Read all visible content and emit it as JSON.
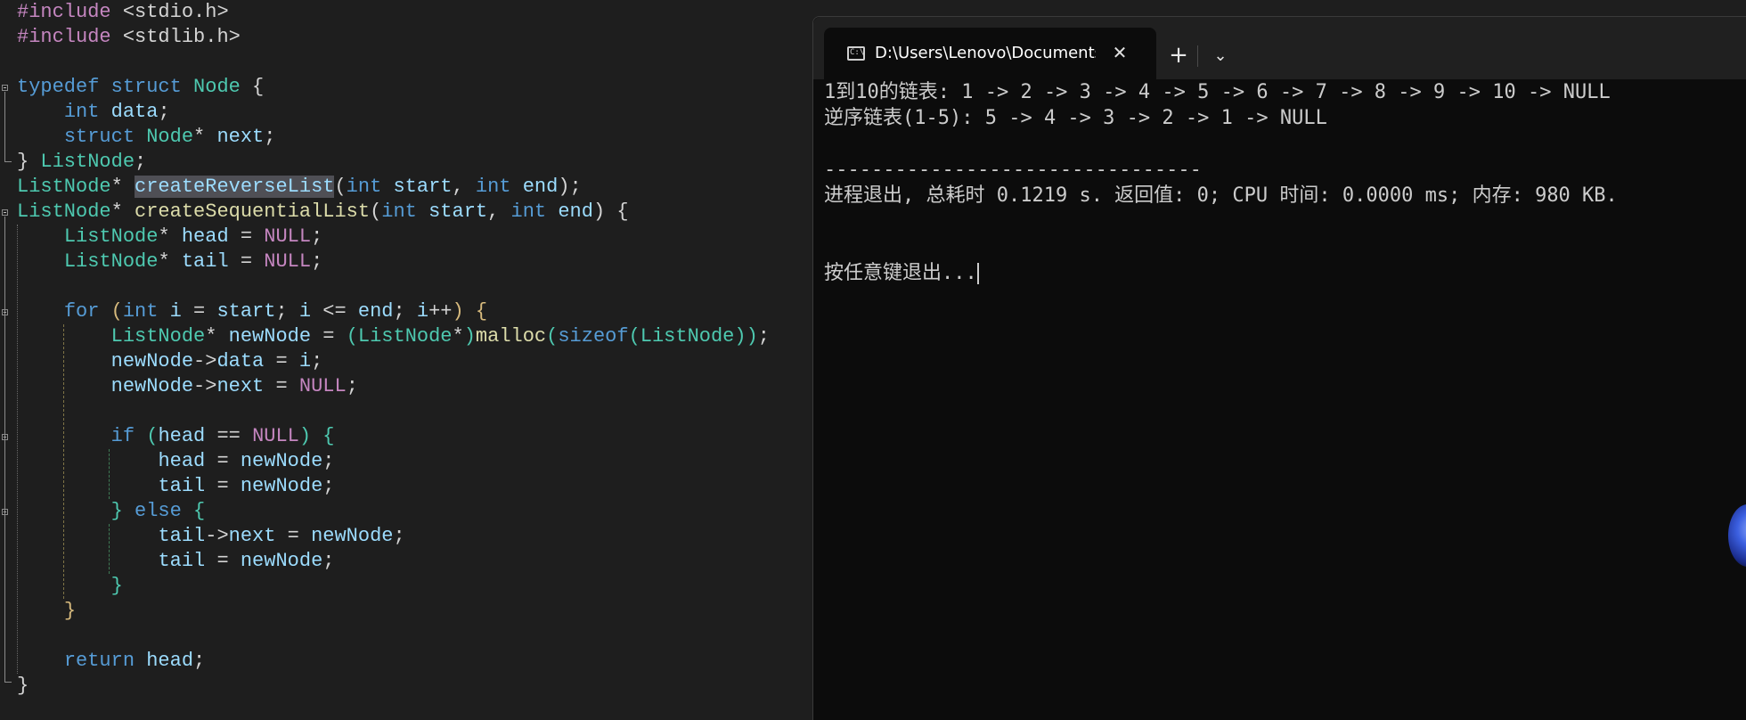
{
  "editor": {
    "lines": [
      [
        [
          "pp",
          "#include "
        ],
        [
          "txt",
          "<stdio.h>"
        ]
      ],
      [
        [
          "pp",
          "#include "
        ],
        [
          "txt",
          "<stdlib.h>"
        ]
      ],
      [],
      [
        [
          "kw",
          "typedef"
        ],
        [
          "txt",
          " "
        ],
        [
          "kw",
          "struct"
        ],
        [
          "txt",
          " "
        ],
        [
          "ty",
          "Node"
        ],
        [
          "txt",
          " {"
        ]
      ],
      [
        [
          "txt",
          "    "
        ],
        [
          "kw",
          "int"
        ],
        [
          "txt",
          " "
        ],
        [
          "va",
          "data"
        ],
        [
          "txt",
          ";"
        ]
      ],
      [
        [
          "txt",
          "    "
        ],
        [
          "kw",
          "struct"
        ],
        [
          "txt",
          " "
        ],
        [
          "ty",
          "Node"
        ],
        [
          "txt",
          "* "
        ],
        [
          "va",
          "next"
        ],
        [
          "txt",
          ";"
        ]
      ],
      [
        [
          "txt",
          "} "
        ],
        [
          "ty",
          "ListNode"
        ],
        [
          "txt",
          ";"
        ]
      ],
      [
        [
          "ty",
          "ListNode"
        ],
        [
          "txt",
          "* "
        ],
        [
          "hl",
          "createReverseList"
        ],
        [
          "txt",
          "("
        ],
        [
          "kw",
          "int"
        ],
        [
          "txt",
          " "
        ],
        [
          "va",
          "start"
        ],
        [
          "txt",
          ", "
        ],
        [
          "kw",
          "int"
        ],
        [
          "txt",
          " "
        ],
        [
          "va",
          "end"
        ],
        [
          "txt",
          ");"
        ]
      ],
      [
        [
          "ty",
          "ListNode"
        ],
        [
          "txt",
          "* "
        ],
        [
          "fn",
          "createSequentialList"
        ],
        [
          "txt",
          "("
        ],
        [
          "kw",
          "int"
        ],
        [
          "txt",
          " "
        ],
        [
          "va",
          "start"
        ],
        [
          "txt",
          ", "
        ],
        [
          "kw",
          "int"
        ],
        [
          "txt",
          " "
        ],
        [
          "va",
          "end"
        ],
        [
          "txt",
          ") {"
        ]
      ],
      [
        [
          "txt",
          "    "
        ],
        [
          "ty",
          "ListNode"
        ],
        [
          "txt",
          "* "
        ],
        [
          "va",
          "head"
        ],
        [
          "txt",
          " = "
        ],
        [
          "nu",
          "NULL"
        ],
        [
          "txt",
          ";"
        ]
      ],
      [
        [
          "txt",
          "    "
        ],
        [
          "ty",
          "ListNode"
        ],
        [
          "txt",
          "* "
        ],
        [
          "va",
          "tail"
        ],
        [
          "txt",
          " = "
        ],
        [
          "nu",
          "NULL"
        ],
        [
          "txt",
          ";"
        ]
      ],
      [],
      [
        [
          "txt",
          "    "
        ],
        [
          "kw",
          "for"
        ],
        [
          "txt",
          " "
        ],
        [
          "pa",
          "("
        ],
        [
          "kw",
          "int"
        ],
        [
          "txt",
          " "
        ],
        [
          "va",
          "i"
        ],
        [
          "txt",
          " = "
        ],
        [
          "va",
          "start"
        ],
        [
          "txt",
          "; "
        ],
        [
          "va",
          "i"
        ],
        [
          "txt",
          " <= "
        ],
        [
          "va",
          "end"
        ],
        [
          "txt",
          "; "
        ],
        [
          "va",
          "i"
        ],
        [
          "txt",
          "++"
        ],
        [
          "pa",
          ")"
        ],
        [
          "txt",
          " "
        ],
        [
          "pa",
          "{"
        ]
      ],
      [
        [
          "txt",
          "        "
        ],
        [
          "ty",
          "ListNode"
        ],
        [
          "txt",
          "* "
        ],
        [
          "va",
          "newNode"
        ],
        [
          "txt",
          " = "
        ],
        [
          "ty",
          "("
        ],
        [
          "ty",
          "ListNode"
        ],
        [
          "txt",
          "*"
        ],
        [
          "ty",
          ")"
        ],
        [
          "fn",
          "malloc"
        ],
        [
          "ty",
          "("
        ],
        [
          "kw",
          "sizeof"
        ],
        [
          "ty",
          "("
        ],
        [
          "ty",
          "ListNode"
        ],
        [
          "ty",
          "))"
        ],
        [
          "txt",
          ";"
        ]
      ],
      [
        [
          "txt",
          "        "
        ],
        [
          "va",
          "newNode"
        ],
        [
          "txt",
          "->"
        ],
        [
          "va",
          "data"
        ],
        [
          "txt",
          " = "
        ],
        [
          "va",
          "i"
        ],
        [
          "txt",
          ";"
        ]
      ],
      [
        [
          "txt",
          "        "
        ],
        [
          "va",
          "newNode"
        ],
        [
          "txt",
          "->"
        ],
        [
          "va",
          "next"
        ],
        [
          "txt",
          " = "
        ],
        [
          "nu",
          "NULL"
        ],
        [
          "txt",
          ";"
        ]
      ],
      [],
      [
        [
          "txt",
          "        "
        ],
        [
          "kw",
          "if"
        ],
        [
          "txt",
          " "
        ],
        [
          "ty",
          "("
        ],
        [
          "va",
          "head"
        ],
        [
          "txt",
          " == "
        ],
        [
          "nu",
          "NULL"
        ],
        [
          "ty",
          ")"
        ],
        [
          "txt",
          " "
        ],
        [
          "ty",
          "{"
        ]
      ],
      [
        [
          "txt",
          "            "
        ],
        [
          "va",
          "head"
        ],
        [
          "txt",
          " = "
        ],
        [
          "va",
          "newNode"
        ],
        [
          "txt",
          ";"
        ]
      ],
      [
        [
          "txt",
          "            "
        ],
        [
          "va",
          "tail"
        ],
        [
          "txt",
          " = "
        ],
        [
          "va",
          "newNode"
        ],
        [
          "txt",
          ";"
        ]
      ],
      [
        [
          "txt",
          "        "
        ],
        [
          "ty",
          "}"
        ],
        [
          "txt",
          " "
        ],
        [
          "kw",
          "else"
        ],
        [
          "txt",
          " "
        ],
        [
          "ty",
          "{"
        ]
      ],
      [
        [
          "txt",
          "            "
        ],
        [
          "va",
          "tail"
        ],
        [
          "txt",
          "->"
        ],
        [
          "va",
          "next"
        ],
        [
          "txt",
          " = "
        ],
        [
          "va",
          "newNode"
        ],
        [
          "txt",
          ";"
        ]
      ],
      [
        [
          "txt",
          "            "
        ],
        [
          "va",
          "tail"
        ],
        [
          "txt",
          " = "
        ],
        [
          "va",
          "newNode"
        ],
        [
          "txt",
          ";"
        ]
      ],
      [
        [
          "txt",
          "        "
        ],
        [
          "ty",
          "}"
        ]
      ],
      [
        [
          "txt",
          "    "
        ],
        [
          "pa",
          "}"
        ]
      ],
      [],
      [
        [
          "txt",
          "    "
        ],
        [
          "kw",
          "return"
        ],
        [
          "txt",
          " "
        ],
        [
          "va",
          "head"
        ],
        [
          "txt",
          ";"
        ]
      ],
      [
        [
          "txt",
          "}"
        ]
      ]
    ]
  },
  "terminal": {
    "tab_title": "D:\\Users\\Lenovo\\Documents\\",
    "tab_icon_glyph": "C:\\",
    "close_glyph": "✕",
    "new_tab_glyph": "+",
    "dropdown_glyph": "⌄",
    "icons": [
      "terminal-icon",
      "close-icon",
      "plus-icon",
      "chevron-down-icon"
    ],
    "lines": [
      "1到10的链表: 1 -> 2 -> 3 -> 4 -> 5 -> 6 -> 7 -> 8 -> 9 -> 10 -> NULL",
      "逆序链表(1-5): 5 -> 4 -> 3 -> 2 -> 1 -> NULL",
      "",
      "--------------------------------",
      "进程退出, 总耗时 0.1219 s. 返回值: 0; CPU 时间: 0.0000 ms; 内存: 980 KB.",
      "",
      "",
      "按任意键退出..."
    ]
  }
}
